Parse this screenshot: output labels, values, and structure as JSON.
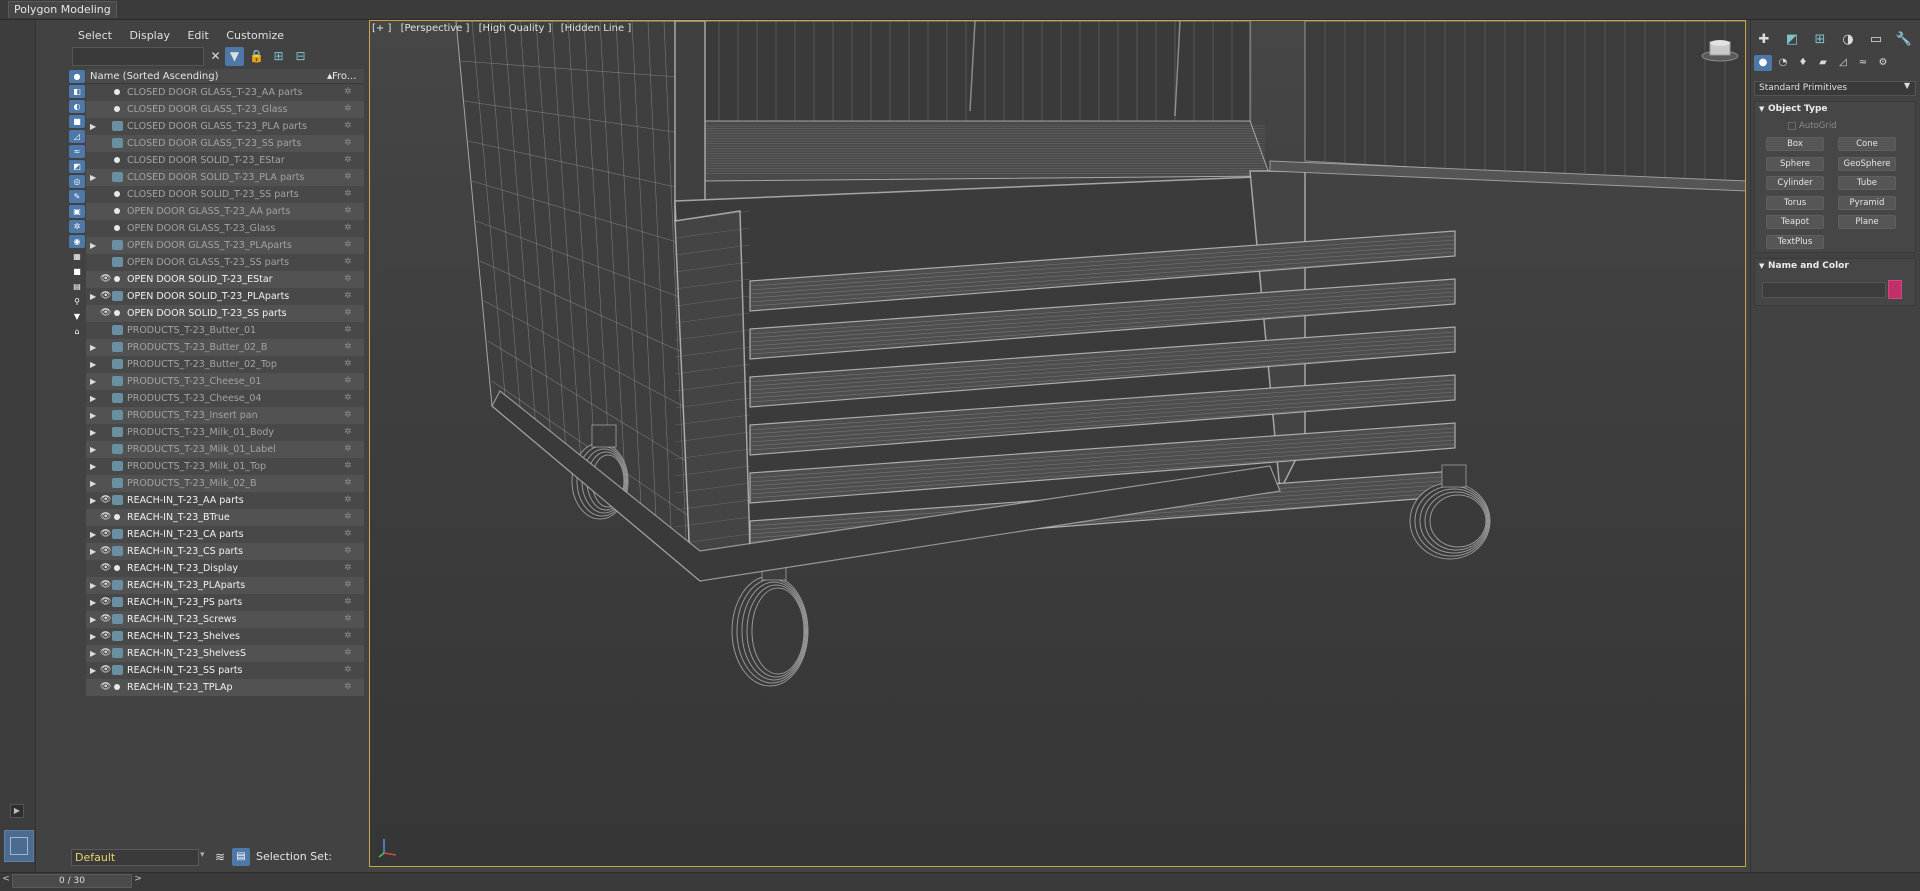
{
  "ribbon": {
    "tab_label": "Polygon Modeling"
  },
  "explorer": {
    "menu": [
      "Select",
      "Display",
      "Edit",
      "Customize"
    ],
    "header": {
      "name_col": "Name (Sorted Ascending)",
      "frozen_col": "Fro..."
    },
    "rows": [
      {
        "name": "CLOSED DOOR GLASS_T-23_AA parts",
        "expand": false,
        "vis": false,
        "type": "dot"
      },
      {
        "name": "CLOSED DOOR GLASS_T-23_Glass",
        "expand": false,
        "vis": false,
        "type": "dot"
      },
      {
        "name": "CLOSED DOOR GLASS_T-23_PLA parts",
        "expand": true,
        "vis": false,
        "type": "layer"
      },
      {
        "name": "CLOSED DOOR GLASS_T-23_SS parts",
        "expand": false,
        "vis": false,
        "type": "layer"
      },
      {
        "name": "CLOSED DOOR SOLID_T-23_EStar",
        "expand": false,
        "vis": false,
        "type": "dot"
      },
      {
        "name": "CLOSED DOOR SOLID_T-23_PLA parts",
        "expand": true,
        "vis": false,
        "type": "layer"
      },
      {
        "name": "CLOSED DOOR SOLID_T-23_SS parts",
        "expand": false,
        "vis": false,
        "type": "dot"
      },
      {
        "name": "OPEN DOOR GLASS_T-23_AA parts",
        "expand": false,
        "vis": false,
        "type": "dot"
      },
      {
        "name": "OPEN DOOR GLASS_T-23_Glass",
        "expand": false,
        "vis": false,
        "type": "dot"
      },
      {
        "name": "OPEN DOOR GLASS_T-23_PLAparts",
        "expand": true,
        "vis": false,
        "type": "layer"
      },
      {
        "name": "OPEN DOOR GLASS_T-23_SS parts",
        "expand": false,
        "vis": false,
        "type": "layer"
      },
      {
        "name": "OPEN DOOR SOLID_T-23_EStar",
        "expand": false,
        "vis": true,
        "type": "dot"
      },
      {
        "name": "OPEN DOOR SOLID_T-23_PLAparts",
        "expand": true,
        "vis": true,
        "type": "layer"
      },
      {
        "name": "OPEN DOOR SOLID_T-23_SS parts",
        "expand": false,
        "vis": true,
        "type": "dot"
      },
      {
        "name": "PRODUCTS_T-23_Butter_01",
        "expand": false,
        "vis": false,
        "type": "layer"
      },
      {
        "name": "PRODUCTS_T-23_Butter_02_B",
        "expand": true,
        "vis": false,
        "type": "layer"
      },
      {
        "name": "PRODUCTS_T-23_Butter_02_Top",
        "expand": true,
        "vis": false,
        "type": "layer"
      },
      {
        "name": "PRODUCTS_T-23_Cheese_01",
        "expand": true,
        "vis": false,
        "type": "layer"
      },
      {
        "name": "PRODUCTS_T-23_Cheese_04",
        "expand": true,
        "vis": false,
        "type": "layer"
      },
      {
        "name": "PRODUCTS_T-23_Insert pan",
        "expand": true,
        "vis": false,
        "type": "layer"
      },
      {
        "name": "PRODUCTS_T-23_Milk_01_Body",
        "expand": true,
        "vis": false,
        "type": "layer"
      },
      {
        "name": "PRODUCTS_T-23_Milk_01_Label",
        "expand": true,
        "vis": false,
        "type": "layer"
      },
      {
        "name": "PRODUCTS_T-23_Milk_01_Top",
        "expand": true,
        "vis": false,
        "type": "layer"
      },
      {
        "name": "PRODUCTS_T-23_Milk_02_B",
        "expand": true,
        "vis": false,
        "type": "layer"
      },
      {
        "name": "REACH-IN_T-23_AA parts",
        "expand": true,
        "vis": true,
        "type": "layer"
      },
      {
        "name": "REACH-IN_T-23_BTrue",
        "expand": false,
        "vis": true,
        "type": "dot"
      },
      {
        "name": "REACH-IN_T-23_CA parts",
        "expand": true,
        "vis": true,
        "type": "layer"
      },
      {
        "name": "REACH-IN_T-23_CS parts",
        "expand": true,
        "vis": true,
        "type": "layer"
      },
      {
        "name": "REACH-IN_T-23_Display",
        "expand": false,
        "vis": true,
        "type": "dot"
      },
      {
        "name": "REACH-IN_T-23_PLAparts",
        "expand": true,
        "vis": true,
        "type": "layer"
      },
      {
        "name": "REACH-IN_T-23_PS parts",
        "expand": true,
        "vis": true,
        "type": "layer"
      },
      {
        "name": "REACH-IN_T-23_Screws",
        "expand": true,
        "vis": true,
        "type": "layer"
      },
      {
        "name": "REACH-IN_T-23_Shelves",
        "expand": true,
        "vis": true,
        "type": "layer"
      },
      {
        "name": "REACH-IN_T-23_ShelvesS",
        "expand": true,
        "vis": true,
        "type": "layer"
      },
      {
        "name": "REACH-IN_T-23_SS parts",
        "expand": true,
        "vis": true,
        "type": "layer"
      },
      {
        "name": "REACH-IN_T-23_TPLAp",
        "expand": false,
        "vis": true,
        "type": "dot"
      }
    ],
    "layer_dropdown": "Default",
    "selection_set_label": "Selection Set:"
  },
  "viewport": {
    "labels": [
      "[+ ]",
      "[Perspective ]",
      "[High Quality ]",
      "[Hidden Line ]"
    ],
    "border_color": "#c9a640",
    "wire_color": "#bfbfbf"
  },
  "command_panel": {
    "dropdown": "Standard Primitives",
    "object_type_title": "Object Type",
    "autogrid_label": "AutoGrid",
    "primitives": [
      "Box",
      "Cone",
      "Sphere",
      "GeoSphere",
      "Cylinder",
      "Tube",
      "Torus",
      "Pyramid",
      "Teapot",
      "Plane",
      "TextPlus"
    ],
    "name_color_title": "Name and Color",
    "object_color": "#c0306a"
  },
  "statusbar": {
    "time_slider": "0 / 30"
  }
}
